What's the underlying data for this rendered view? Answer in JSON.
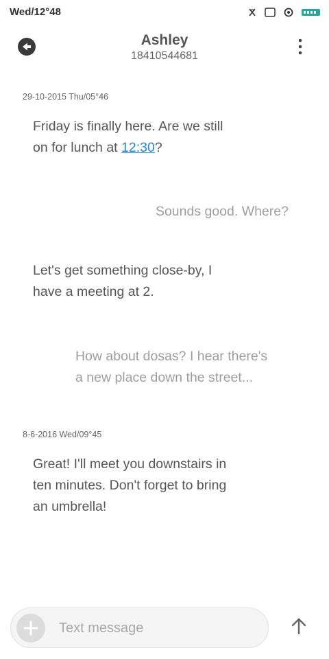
{
  "status_bar": {
    "time": "Wed/12°48",
    "icons": [
      "notification-muted-icon",
      "screen-icon",
      "sync-icon",
      "battery-icon"
    ],
    "battery_color": "#26a69a"
  },
  "header": {
    "contact_name": "Ashley",
    "contact_number": "18410544681"
  },
  "thread": {
    "groups": [
      {
        "timestamp": "29-10-2015 Thu/05°46"
      },
      {
        "timestamp": "8-6-2016 Wed/09°45"
      }
    ],
    "messages": [
      {
        "direction": "received",
        "line1": "Friday is finally here. Are we still",
        "line2_prefix": "on for lunch at ",
        "line2_link": "12:30",
        "line2_suffix": "?"
      },
      {
        "direction": "sent",
        "text": "Sounds good. Where?"
      },
      {
        "direction": "received",
        "line1": "Let's get something close-by, I",
        "line2": "have a meeting at 2."
      },
      {
        "direction": "sent",
        "line1": "How about dosas? I hear there's",
        "line2": "a new place down the street..."
      },
      {
        "direction": "received",
        "line1": "Great! I'll meet you downstairs in",
        "line2": "ten minutes. Don't forget to bring",
        "line3": "an umbrella!"
      }
    ],
    "link_color": "#1e88e5"
  },
  "composer": {
    "placeholder": "Text message",
    "value": ""
  }
}
